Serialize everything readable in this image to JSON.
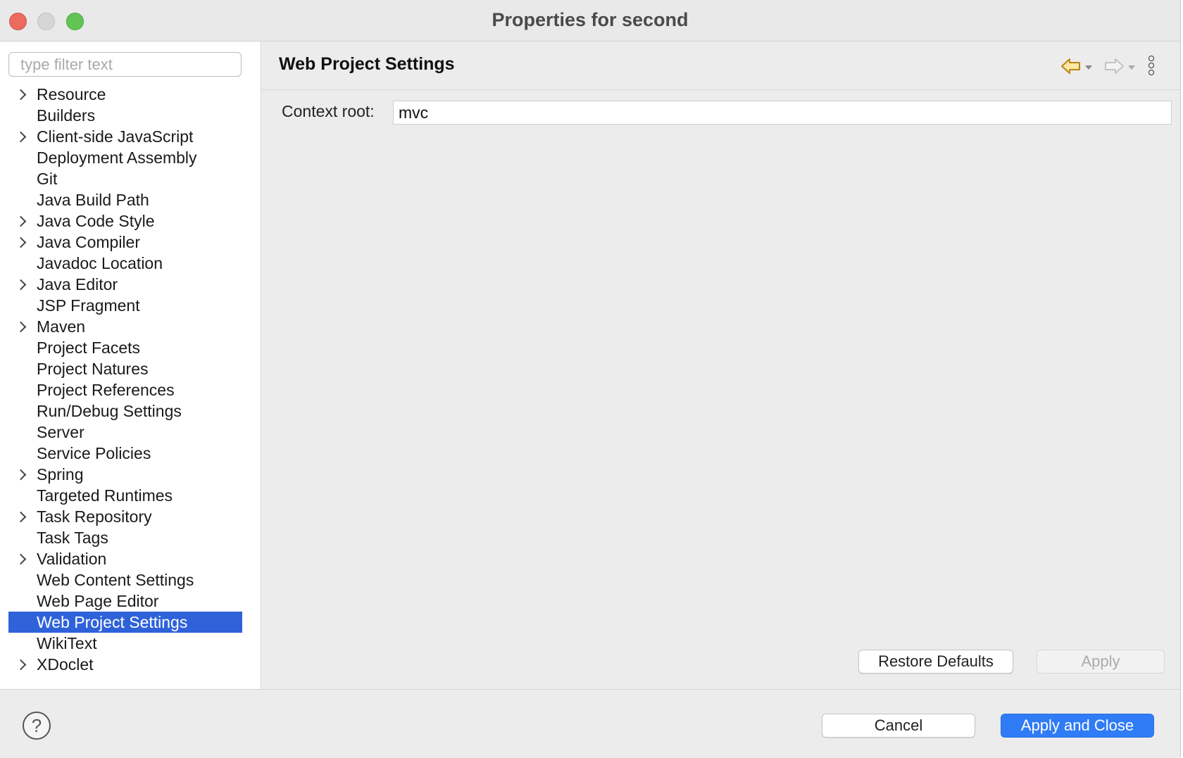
{
  "window": {
    "title": "Properties for second"
  },
  "sidebar": {
    "filter_placeholder": "type filter text",
    "items": [
      {
        "label": "Resource",
        "expandable": true
      },
      {
        "label": "Builders",
        "expandable": false
      },
      {
        "label": "Client-side JavaScript",
        "expandable": true
      },
      {
        "label": "Deployment Assembly",
        "expandable": false
      },
      {
        "label": "Git",
        "expandable": false
      },
      {
        "label": "Java Build Path",
        "expandable": false
      },
      {
        "label": "Java Code Style",
        "expandable": true
      },
      {
        "label": "Java Compiler",
        "expandable": true
      },
      {
        "label": "Javadoc Location",
        "expandable": false
      },
      {
        "label": "Java Editor",
        "expandable": true
      },
      {
        "label": "JSP Fragment",
        "expandable": false
      },
      {
        "label": "Maven",
        "expandable": true
      },
      {
        "label": "Project Facets",
        "expandable": false
      },
      {
        "label": "Project Natures",
        "expandable": false
      },
      {
        "label": "Project References",
        "expandable": false
      },
      {
        "label": "Run/Debug Settings",
        "expandable": false
      },
      {
        "label": "Server",
        "expandable": false
      },
      {
        "label": "Service Policies",
        "expandable": false
      },
      {
        "label": "Spring",
        "expandable": true
      },
      {
        "label": "Targeted Runtimes",
        "expandable": false
      },
      {
        "label": "Task Repository",
        "expandable": true
      },
      {
        "label": "Task Tags",
        "expandable": false
      },
      {
        "label": "Validation",
        "expandable": true
      },
      {
        "label": "Web Content Settings",
        "expandable": false
      },
      {
        "label": "Web Page Editor",
        "expandable": false
      },
      {
        "label": "Web Project Settings",
        "expandable": false,
        "selected": true
      },
      {
        "label": "WikiText",
        "expandable": false
      },
      {
        "label": "XDoclet",
        "expandable": true
      }
    ]
  },
  "main": {
    "title": "Web Project Settings",
    "icons": {
      "back": "back-arrow-icon",
      "forward": "forward-arrow-icon",
      "menu": "more-vertical-icon"
    },
    "context_root_label": "Context root:",
    "context_root_value": "mvc",
    "restore_defaults_label": "Restore Defaults",
    "apply_label": "Apply"
  },
  "footer": {
    "help_icon": "help-icon",
    "help_glyph": "?",
    "cancel_label": "Cancel",
    "apply_close_label": "Apply and Close"
  },
  "colors": {
    "selection": "#2f62d9",
    "primary_button": "#2f7cf6",
    "back_arrow": "#c9961a"
  }
}
